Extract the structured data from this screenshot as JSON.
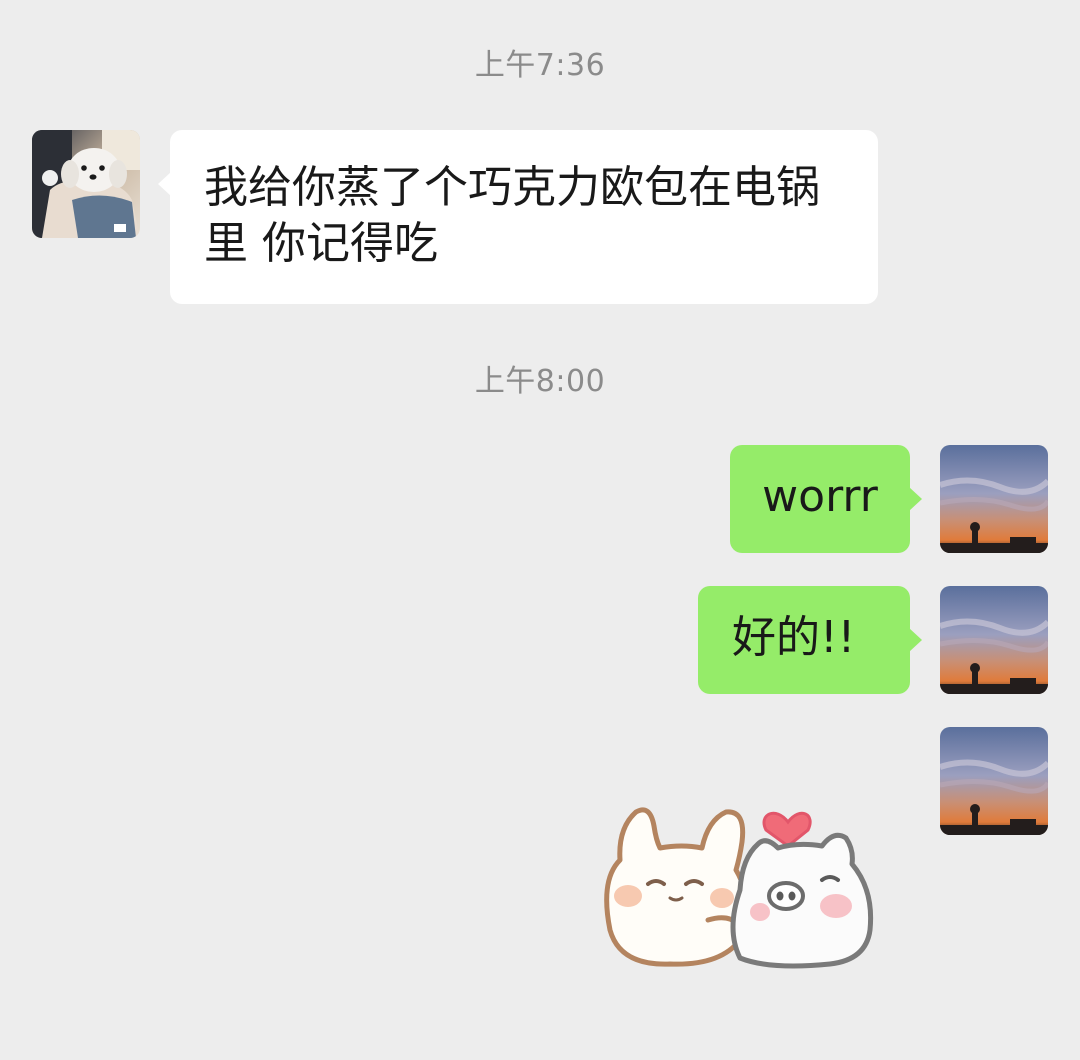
{
  "timestamps": [
    "上午7:36",
    "上午8:00"
  ],
  "messages": [
    {
      "sender": "other",
      "avatar": "dog-photo-avatar",
      "text": "我给你蒸了个巧克力欧包在电锅里 你记得吃"
    },
    {
      "sender": "self",
      "avatar": "sunset-photo-avatar",
      "text": "worrr"
    },
    {
      "sender": "self",
      "avatar": "sunset-photo-avatar",
      "text": "好的!!"
    },
    {
      "sender": "self",
      "avatar": "sunset-photo-avatar",
      "sticker": "bunny-and-pig-hug-sticker"
    }
  ],
  "colors": {
    "background": "#ededed",
    "self_bubble": "#95ec69",
    "other_bubble": "#ffffff",
    "timestamp_text": "#8b8b8b"
  }
}
